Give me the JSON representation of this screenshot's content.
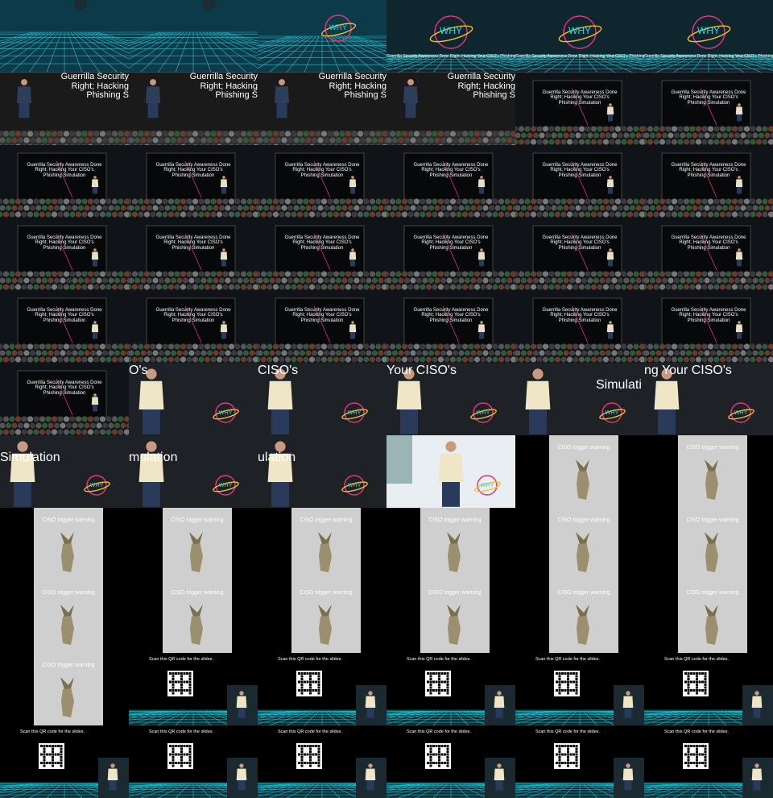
{
  "talk_title": {
    "full": "Guerrilla Security Awareness Done Right; Hacking Your CISO's Phishing Simulation",
    "line1": "Guerrilla Security Awareness Done",
    "line2": "Right; Hacking Your CISO's",
    "line3": "Phishing Simulation",
    "big_line1": "Guerrilla Security",
    "big_line2": "Right; Hacking",
    "big_line3": "Phishing S"
  },
  "logo_text": "WHY",
  "fragments": {
    "f1": "O's",
    "f2": "CISO's",
    "f3": "Your CISO's",
    "f4": "Simulati",
    "f5": "ng Your CISO's",
    "f6": "Simulation",
    "f7": "Your CISO's",
    "f8": "mulation",
    "f9": "Your CISO's",
    "f10": "ulation"
  },
  "ciso_caption": "CISO trigger warning",
  "qr_caption": "Scan this QR code for the slides.",
  "colors": {
    "grid_cyan": "#27d9e8",
    "neon_pink": "#e0357c",
    "stage_dark": "#101418",
    "slide_gray": "#cfcfcf"
  },
  "tiles": [
    "grid",
    "grid",
    "logo-grid",
    "logo-space",
    "logo-space",
    "logo-space",
    "stage-close",
    "stage-close",
    "stage-close",
    "stage-close",
    "stage-wide",
    "stage-wide",
    "stage-wide",
    "stage-wide",
    "stage-wide",
    "stage-wide",
    "stage-wide",
    "stage-wide",
    "stage-wide",
    "stage-wide",
    "stage-wide",
    "stage-wide",
    "stage-wide",
    "stage-wide",
    "stage-wide",
    "stage-wide",
    "stage-wide",
    "stage-wide",
    "stage-wide",
    "stage-wide",
    "stage-wide",
    "speaker-f1",
    "speaker-f2",
    "speaker-f3",
    "speaker-f3b",
    "speaker-f4",
    "speaker-f5",
    "speaker-f7",
    "speaker-f9",
    "speaker-bright",
    "ciso",
    "ciso",
    "ciso",
    "ciso",
    "ciso",
    "ciso",
    "ciso",
    "ciso",
    "ciso",
    "ciso",
    "ciso",
    "ciso",
    "ciso",
    "ciso",
    "ciso",
    "qr",
    "qr",
    "qr",
    "qr",
    "qr",
    "qr",
    "qr",
    "qr",
    "qr",
    "qr",
    "qr"
  ]
}
